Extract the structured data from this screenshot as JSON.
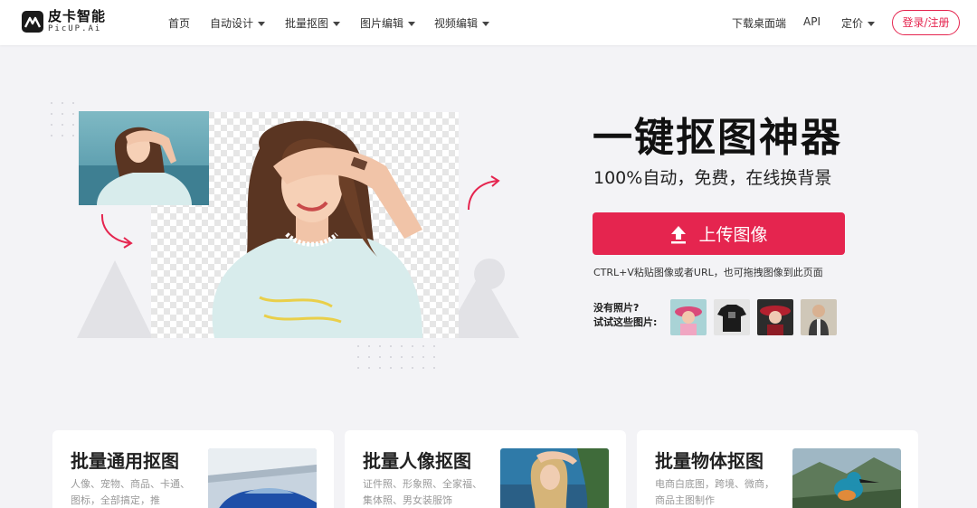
{
  "nav": {
    "logo_cn": "皮卡智能",
    "logo_en": "PicUP.Ai",
    "items": [
      {
        "label": "首页"
      },
      {
        "label": "自动设计"
      },
      {
        "label": "批量抠图"
      },
      {
        "label": "图片编辑"
      },
      {
        "label": "视频编辑"
      }
    ],
    "download": "下载桌面端",
    "api": "API",
    "pricing": "定价",
    "login": "登录/注册"
  },
  "hero": {
    "title": "一键抠图神器",
    "subtitle": "100%自动，免费，在线换背景",
    "upload_label": "上传图像",
    "hint": "CTRL+V粘贴图像或者URL，也可拖拽图像到此页面",
    "no_photo": "没有照片?",
    "try_these": "试试这些图片:"
  },
  "cards": [
    {
      "title": "批量通用抠图",
      "desc": "人像、宠物、商品、卡通、图标，全部搞定，推"
    },
    {
      "title": "批量人像抠图",
      "desc": "证件照、形象照、全家福、集体照、男女装服饰"
    },
    {
      "title": "批量物体抠图",
      "desc": "电商白底图，跨境、微商，商品主图制作"
    }
  ],
  "colors": {
    "accent": "#e5254f",
    "background": "#f3f3f6"
  },
  "icons": [
    "upload-icon",
    "caret-down-icon",
    "curved-arrow-icon"
  ]
}
